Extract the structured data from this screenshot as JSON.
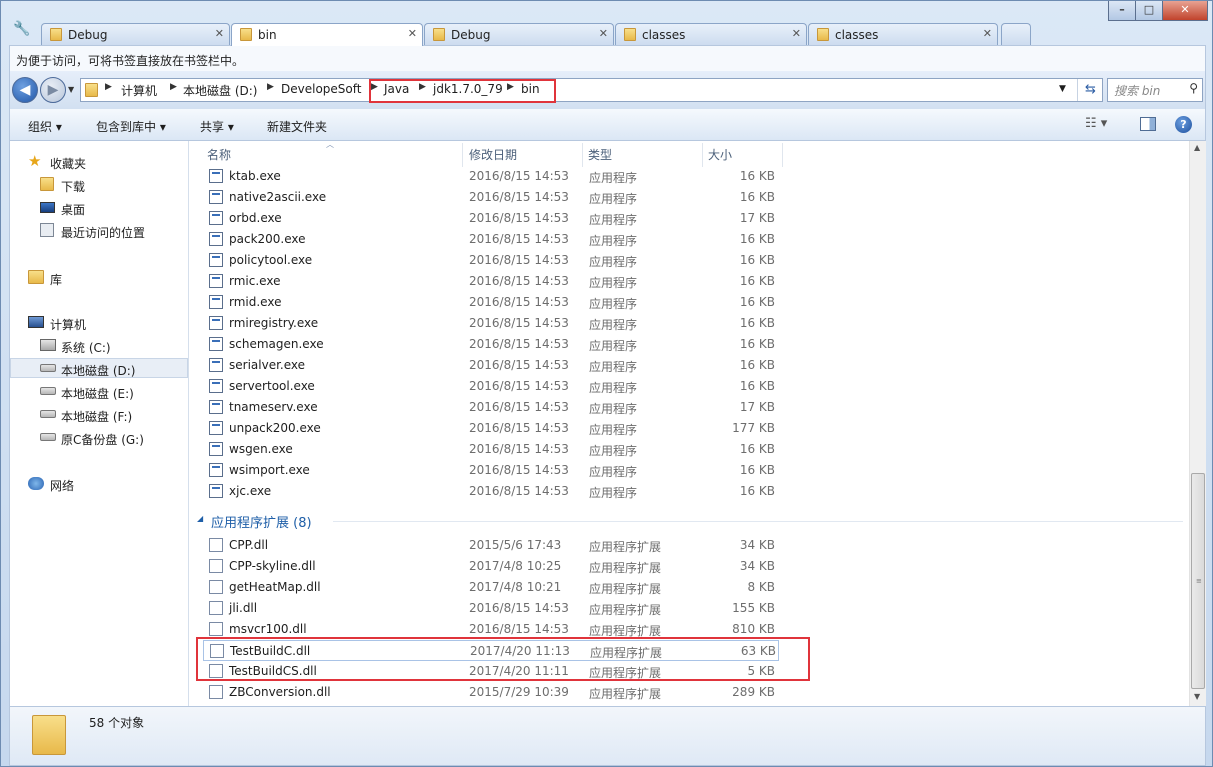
{
  "tabs": [
    {
      "label": "Debug",
      "active": false
    },
    {
      "label": "bin",
      "active": true
    },
    {
      "label": "Debug",
      "active": false
    },
    {
      "label": "classes",
      "active": false
    },
    {
      "label": "classes",
      "active": false
    }
  ],
  "window_controls": {
    "minimize": "–",
    "maximize": "□",
    "close": "✕"
  },
  "bookmark_bar_text": "为便于访问，可将书签直接放在书签栏中。",
  "breadcrumb": [
    "计算机",
    "本地磁盘 (D:)",
    "DevelopeSoft",
    "Java",
    "jdk1.7.0_79",
    "bin"
  ],
  "search_placeholder": "搜索 bin",
  "toolbar": {
    "organize": "组织 ▾",
    "include": "包含到库中 ▾",
    "share": "共享 ▾",
    "new_folder": "新建文件夹"
  },
  "nav": {
    "favorites": "收藏夹",
    "downloads": "下载",
    "desktop": "桌面",
    "recent": "最近访问的位置",
    "libraries": "库",
    "computer": "计算机",
    "drive_c": "系统 (C:)",
    "drive_d": "本地磁盘 (D:)",
    "drive_e": "本地磁盘 (E:)",
    "drive_f": "本地磁盘 (F:)",
    "drive_g": "原C备份盘 (G:)",
    "network": "网络"
  },
  "columns": {
    "name": "名称",
    "date": "修改日期",
    "type": "类型",
    "size": "大小"
  },
  "exe_files": [
    {
      "name": "ktab.exe",
      "date": "2016/8/15 14:53",
      "type": "应用程序",
      "size": "16 KB"
    },
    {
      "name": "native2ascii.exe",
      "date": "2016/8/15 14:53",
      "type": "应用程序",
      "size": "16 KB"
    },
    {
      "name": "orbd.exe",
      "date": "2016/8/15 14:53",
      "type": "应用程序",
      "size": "17 KB"
    },
    {
      "name": "pack200.exe",
      "date": "2016/8/15 14:53",
      "type": "应用程序",
      "size": "16 KB"
    },
    {
      "name": "policytool.exe",
      "date": "2016/8/15 14:53",
      "type": "应用程序",
      "size": "16 KB"
    },
    {
      "name": "rmic.exe",
      "date": "2016/8/15 14:53",
      "type": "应用程序",
      "size": "16 KB"
    },
    {
      "name": "rmid.exe",
      "date": "2016/8/15 14:53",
      "type": "应用程序",
      "size": "16 KB"
    },
    {
      "name": "rmiregistry.exe",
      "date": "2016/8/15 14:53",
      "type": "应用程序",
      "size": "16 KB"
    },
    {
      "name": "schemagen.exe",
      "date": "2016/8/15 14:53",
      "type": "应用程序",
      "size": "16 KB"
    },
    {
      "name": "serialver.exe",
      "date": "2016/8/15 14:53",
      "type": "应用程序",
      "size": "16 KB"
    },
    {
      "name": "servertool.exe",
      "date": "2016/8/15 14:53",
      "type": "应用程序",
      "size": "16 KB"
    },
    {
      "name": "tnameserv.exe",
      "date": "2016/8/15 14:53",
      "type": "应用程序",
      "size": "17 KB"
    },
    {
      "name": "unpack200.exe",
      "date": "2016/8/15 14:53",
      "type": "应用程序",
      "size": "177 KB"
    },
    {
      "name": "wsgen.exe",
      "date": "2016/8/15 14:53",
      "type": "应用程序",
      "size": "16 KB"
    },
    {
      "name": "wsimport.exe",
      "date": "2016/8/15 14:53",
      "type": "应用程序",
      "size": "16 KB"
    },
    {
      "name": "xjc.exe",
      "date": "2016/8/15 14:53",
      "type": "应用程序",
      "size": "16 KB"
    }
  ],
  "group_header": "应用程序扩展 (8)",
  "dll_files": [
    {
      "name": "CPP.dll",
      "date": "2015/5/6 17:43",
      "type": "应用程序扩展",
      "size": "34 KB"
    },
    {
      "name": "CPP-skyline.dll",
      "date": "2017/4/8 10:25",
      "type": "应用程序扩展",
      "size": "34 KB"
    },
    {
      "name": "getHeatMap.dll",
      "date": "2017/4/8 10:21",
      "type": "应用程序扩展",
      "size": "8 KB"
    },
    {
      "name": "jli.dll",
      "date": "2016/8/15 14:53",
      "type": "应用程序扩展",
      "size": "155 KB"
    },
    {
      "name": "msvcr100.dll",
      "date": "2016/8/15 14:53",
      "type": "应用程序扩展",
      "size": "810 KB"
    },
    {
      "name": "TestBuildC.dll",
      "date": "2017/4/20 11:13",
      "type": "应用程序扩展",
      "size": "63 KB"
    },
    {
      "name": "TestBuildCS.dll",
      "date": "2017/4/20 11:11",
      "type": "应用程序扩展",
      "size": "5 KB"
    },
    {
      "name": "ZBConversion.dll",
      "date": "2015/7/29 10:39",
      "type": "应用程序扩展",
      "size": "289 KB"
    }
  ],
  "status_text": "58 个对象",
  "colors": {
    "highlight_border": "#e0343b",
    "accent": "#1f5fa8"
  }
}
